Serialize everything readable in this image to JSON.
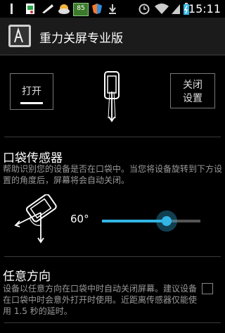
{
  "status_bar": {
    "time": "15:11",
    "battery_badge": "85",
    "icons": [
      "debug-icon",
      "image-icon",
      "weather-icon",
      "battery-app-icon",
      "shield-icon",
      "download-icon",
      "alarm-icon",
      "wifi-icon",
      "signal-icon",
      "battery-icon"
    ]
  },
  "app_bar": {
    "title": "重力关屏专业版",
    "icon": "app-logo-icon"
  },
  "toggles": {
    "open_label": "打开",
    "close_label": "关闭\n设置"
  },
  "pocket_sensor": {
    "title": "口袋传感器",
    "description": "帮助识别您的设备是否在口袋中。当您将设备旋转到下方设置的角度后，屏幕将会自动关闭。",
    "angle_label": "60°",
    "slider_fraction": 0.66
  },
  "any_direction": {
    "title": "任意方向",
    "description": "设备以任意方向在口袋中时自动关闭屏幕。建议设备在口袋中时会意外打开时使用。近距离传感器仅能使用 1.5 秒的延时。",
    "checked": false
  },
  "colors": {
    "accent": "#33b5e5",
    "background": "#000000",
    "action_bar": "#1b1b1b"
  }
}
